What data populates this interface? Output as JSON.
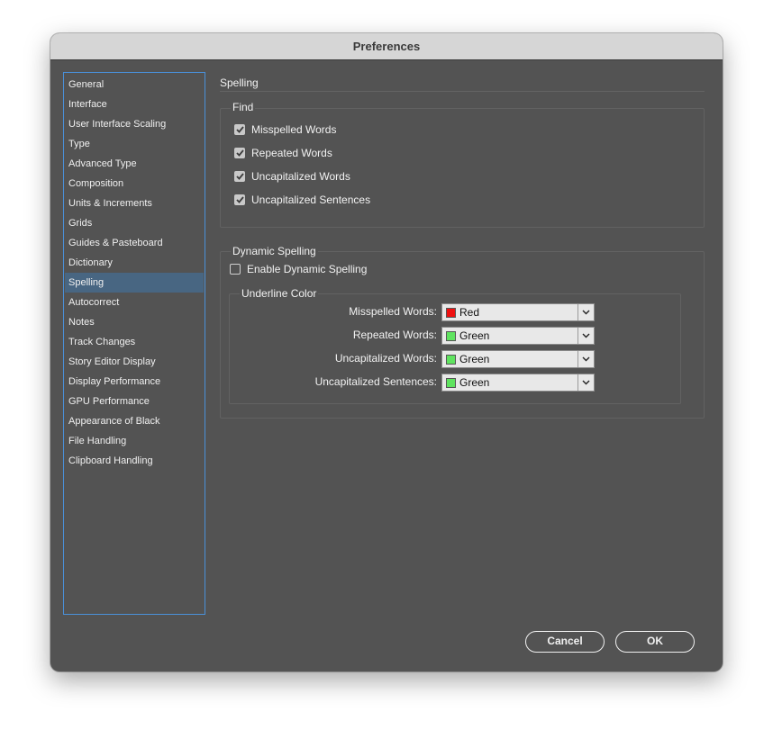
{
  "window": {
    "title": "Preferences"
  },
  "sidebar": {
    "selected": "Spelling",
    "items": [
      "General",
      "Interface",
      "User Interface Scaling",
      "Type",
      "Advanced Type",
      "Composition",
      "Units & Increments",
      "Grids",
      "Guides & Pasteboard",
      "Dictionary",
      "Spelling",
      "Autocorrect",
      "Notes",
      "Track Changes",
      "Story Editor Display",
      "Display Performance",
      "GPU Performance",
      "Appearance of Black",
      "File Handling",
      "Clipboard Handling"
    ]
  },
  "pane": {
    "title": "Spelling",
    "find": {
      "label": "Find",
      "options": [
        {
          "label": "Misspelled Words",
          "checked": true
        },
        {
          "label": "Repeated Words",
          "checked": true
        },
        {
          "label": "Uncapitalized Words",
          "checked": true
        },
        {
          "label": "Uncapitalized Sentences",
          "checked": true
        }
      ]
    },
    "dynamic": {
      "label": "Dynamic Spelling",
      "enable": {
        "label": "Enable Dynamic Spelling",
        "checked": false
      },
      "underline": {
        "label": "Underline Color",
        "rows": [
          {
            "label": "Misspelled Words:",
            "value": "Red",
            "color": "#ee1111"
          },
          {
            "label": "Repeated Words:",
            "value": "Green",
            "color": "#5fe35f"
          },
          {
            "label": "Uncapitalized Words:",
            "value": "Green",
            "color": "#5fe35f"
          },
          {
            "label": "Uncapitalized Sentences:",
            "value": "Green",
            "color": "#5fe35f"
          }
        ]
      }
    }
  },
  "buttons": {
    "cancel": "Cancel",
    "ok": "OK"
  },
  "icons": {
    "checkbox_check": "checkmark-icon",
    "dropdown": "chevron-down-icon"
  }
}
